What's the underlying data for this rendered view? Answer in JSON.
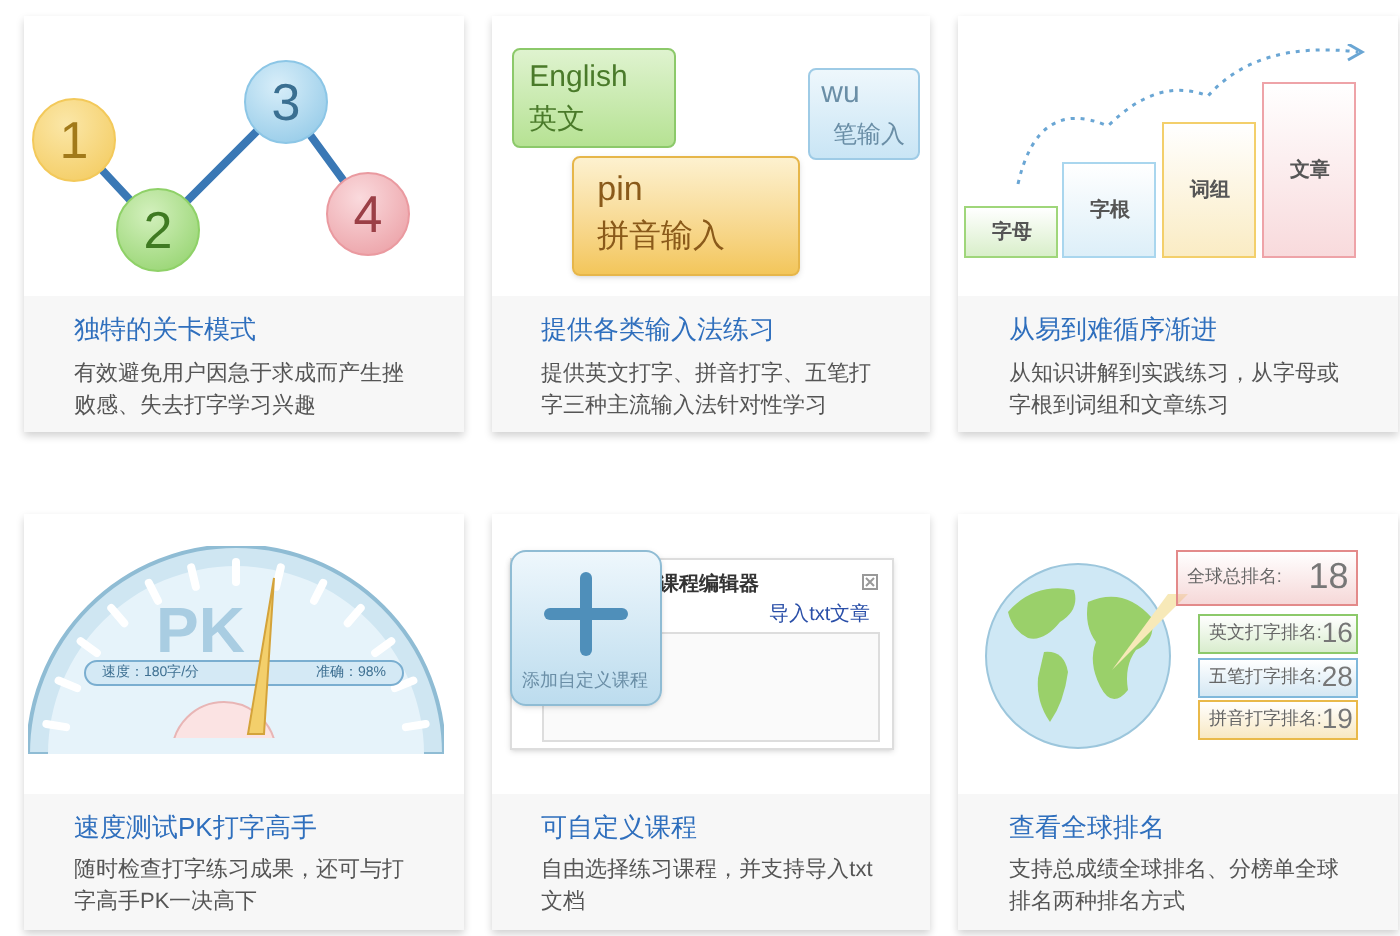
{
  "cards": [
    {
      "kind": "levels",
      "levels": [
        "1",
        "2",
        "3",
        "4"
      ],
      "title": "独特的关卡模式",
      "description": "有效避免用户因急于求成而产生挫败感、失去打字学习兴趣"
    },
    {
      "kind": "inputs",
      "english": {
        "word": "English",
        "caption": "英文"
      },
      "wubi": {
        "word": "wu",
        "caption": "笔输入"
      },
      "pinyin": {
        "word": "pin",
        "caption": "拼音输入"
      },
      "title": "提供各类输入法练习",
      "description": "提供英文打字、拼音打字、五笔打字三种主流输入法针对性学习"
    },
    {
      "kind": "stairs",
      "steps": [
        {
          "label": "字母",
          "color": "#9fd67a"
        },
        {
          "label": "字根",
          "color": "#a9d6ee"
        },
        {
          "label": "词组",
          "color": "#f3cf6b"
        },
        {
          "label": "文章",
          "color": "#eea3a8"
        }
      ],
      "title": "从易到难循序渐进",
      "description": "从知识讲解到实践练习，从字母或字根到词组和文章练习"
    },
    {
      "kind": "gauge",
      "badge": "PK",
      "readings": [
        "速度：180字/分",
        "准确：98%"
      ],
      "title": "速度测试PK打字高手",
      "description": "随时检查打字练习成果，还可与打字高手PK一决高下"
    },
    {
      "kind": "editor",
      "add_label": "添加自定义课程",
      "window_title": "课程编辑器",
      "import_link": "导入txt文章",
      "title": "可自定义课程",
      "description": "自由选择练习课程，并支持导入txt文档"
    },
    {
      "kind": "ranking",
      "ranks": [
        {
          "label": "全球总排名:",
          "value": "18",
          "color": "#e38a8a"
        },
        {
          "label": "英文打字排名:",
          "value": "16",
          "color": "#8cc96a"
        },
        {
          "label": "五笔打字排名:",
          "value": "28",
          "color": "#7fb8db"
        },
        {
          "label": "拼音打字排名:",
          "value": "19",
          "color": "#e9b94a"
        }
      ],
      "title": "查看全球排名",
      "description": "支持总成绩全球排名、分榜单全球排名两种排名方式"
    }
  ]
}
